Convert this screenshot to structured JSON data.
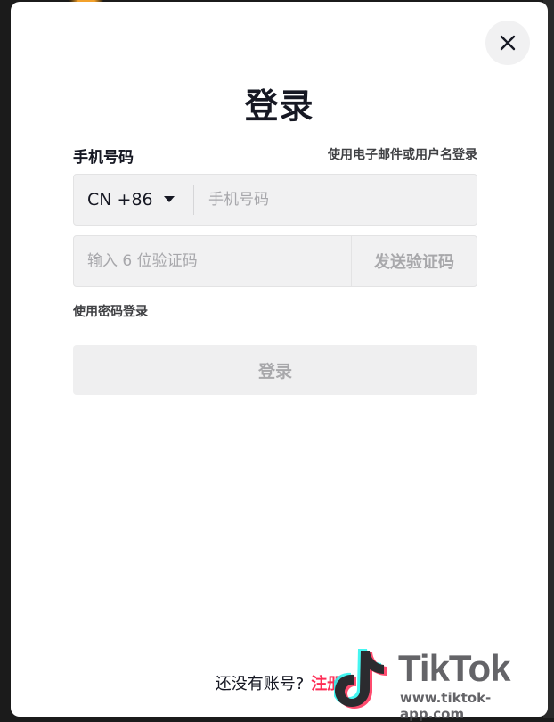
{
  "modal": {
    "title": "登录",
    "phone_label": "手机号码",
    "alt_login_link": "使用电子邮件或用户名登录",
    "country_code": "CN +86",
    "phone_placeholder": "手机号码",
    "code_placeholder": "输入 6 位验证码",
    "send_code_button": "发送验证码",
    "password_login_link": "使用密码登录",
    "login_button": "登录",
    "footer_prompt": "还没有账号?",
    "signup_link": "注册"
  },
  "watermark": {
    "brand": "TikTok",
    "url": "www.tiktok-app.com"
  },
  "colors": {
    "accent": "#fe2c55",
    "text_primary": "#161823",
    "disabled_text": "#a8a8ab",
    "input_bg": "#f1f1f2"
  },
  "icons": {
    "close": "close-icon",
    "dropdown": "caret-down-icon",
    "logo": "tiktok-note-icon"
  }
}
